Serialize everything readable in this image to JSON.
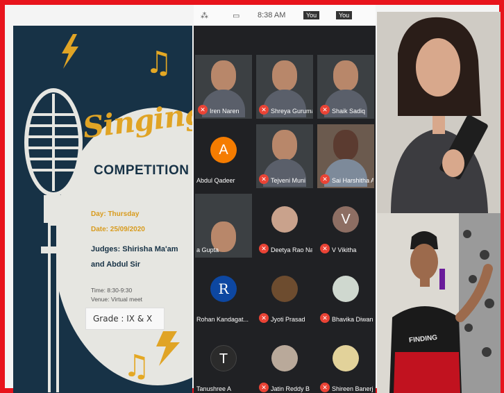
{
  "status_bar": {
    "time": "8:38 AM",
    "label_you": "You",
    "label_you_short": "You"
  },
  "poster": {
    "title_script": "Singing",
    "title_main": "COMPETITION",
    "day": "Day: Thursday",
    "date": "Date: 25/09/2020",
    "judges_line1": "Judges: Shirisha Ma'am",
    "judges_line2": "and Abdul Sir",
    "time": "Time: 8:30-9:30",
    "venue": "Venue: Virtual meet",
    "grade": "Grade : IX & X",
    "colors": {
      "navy": "#173246",
      "gold": "#e0a425",
      "cream": "#e6e6e1"
    }
  },
  "participants": [
    {
      "name": "Iren Naren",
      "muted": true
    },
    {
      "name": "Shreya Guruma...",
      "muted": true
    },
    {
      "name": "Shaik Sadiq",
      "muted": true
    },
    {
      "name": "Abdul Qadeer",
      "muted": false,
      "avatar": "A",
      "avatar_color": "#f57c00"
    },
    {
      "name": "Tejveni Muni",
      "muted": true
    },
    {
      "name": "Sai Harshitha Ak...",
      "muted": true
    },
    {
      "name": "a Gupta",
      "muted": false
    },
    {
      "name": "Deetya Rao Nadi...",
      "muted": true
    },
    {
      "name": "V Vikitha",
      "muted": true,
      "avatar": "V",
      "avatar_color": "#8d6e63"
    },
    {
      "name": "Rohan Kandagat...",
      "muted": false,
      "avatar": "R",
      "avatar_color": "#0d47a1"
    },
    {
      "name": "Jyoti Prasad",
      "muted": true
    },
    {
      "name": "Bhavika Diwan",
      "muted": true
    },
    {
      "name": "Tanushree A",
      "muted": false,
      "avatar": "T",
      "avatar_color": "#2b2b2b"
    },
    {
      "name": "Jatin Reddy B",
      "muted": true
    },
    {
      "name": "Shireen Banerjee",
      "muted": true
    }
  ],
  "jersey_text": "FINDING",
  "icons": {
    "mute": "mic-off-icon",
    "note": "music-note-icon",
    "bolt": "lightning-bolt-icon",
    "mic": "vintage-microphone-icon"
  },
  "accent": "#e8141c"
}
